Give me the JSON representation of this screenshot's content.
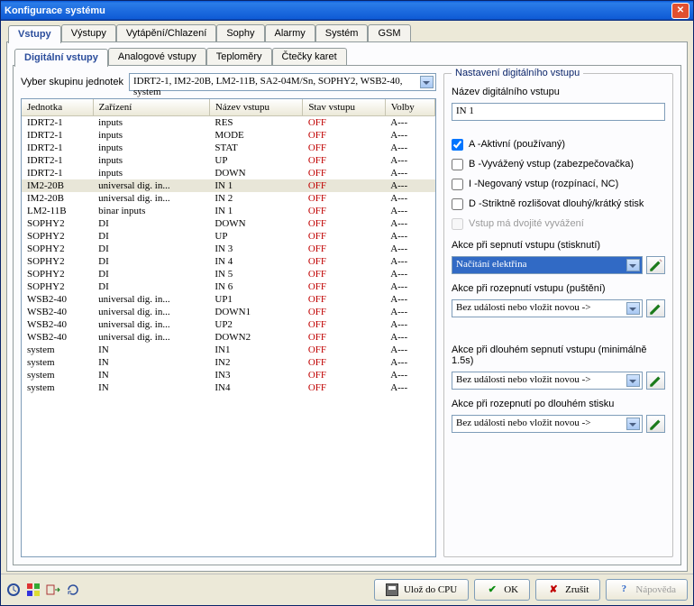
{
  "window": {
    "title": "Konfigurace systému"
  },
  "mainTabs": [
    "Vstupy",
    "Výstupy",
    "Vytápění/Chlazení",
    "Sophy",
    "Alarmy",
    "Systém",
    "GSM"
  ],
  "mainTabActive": 0,
  "subTabs": [
    "Digitální vstupy",
    "Analogové vstupy",
    "Teploměry",
    "Čtečky karet"
  ],
  "subTabActive": 0,
  "picker": {
    "label": "Vyber skupinu jednotek",
    "value": "IDRT2-1, IM2-20B, LM2-11B, SA2-04M/Sn, SOPHY2, WSB2-40, system"
  },
  "columns": [
    "Jednotka",
    "Zařízení",
    "Název vstupu",
    "Stav vstupu",
    "Volby"
  ],
  "rows": [
    {
      "u": "IDRT2-1",
      "d": "inputs",
      "n": "RES",
      "s": "OFF",
      "v": "A---"
    },
    {
      "u": "IDRT2-1",
      "d": "inputs",
      "n": "MODE",
      "s": "OFF",
      "v": "A---"
    },
    {
      "u": "IDRT2-1",
      "d": "inputs",
      "n": "STAT",
      "s": "OFF",
      "v": "A---"
    },
    {
      "u": "IDRT2-1",
      "d": "inputs",
      "n": "UP",
      "s": "OFF",
      "v": "A---"
    },
    {
      "u": "IDRT2-1",
      "d": "inputs",
      "n": "DOWN",
      "s": "OFF",
      "v": "A---"
    },
    {
      "u": "IM2-20B",
      "d": "universal dig. in...",
      "n": "IN 1",
      "s": "OFF",
      "v": "A---",
      "sel": true
    },
    {
      "u": "IM2-20B",
      "d": "universal dig. in...",
      "n": "IN 2",
      "s": "OFF",
      "v": "A---"
    },
    {
      "u": "LM2-11B",
      "d": "binar inputs",
      "n": "IN 1",
      "s": "OFF",
      "v": "A---"
    },
    {
      "u": "SOPHY2",
      "d": "DI",
      "n": "DOWN",
      "s": "OFF",
      "v": "A---"
    },
    {
      "u": "SOPHY2",
      "d": "DI",
      "n": "UP",
      "s": "OFF",
      "v": "A---"
    },
    {
      "u": "SOPHY2",
      "d": "DI",
      "n": "IN 3",
      "s": "OFF",
      "v": "A---"
    },
    {
      "u": "SOPHY2",
      "d": "DI",
      "n": "IN 4",
      "s": "OFF",
      "v": "A---"
    },
    {
      "u": "SOPHY2",
      "d": "DI",
      "n": "IN 5",
      "s": "OFF",
      "v": "A---"
    },
    {
      "u": "SOPHY2",
      "d": "DI",
      "n": "IN 6",
      "s": "OFF",
      "v": "A---"
    },
    {
      "u": "WSB2-40",
      "d": "universal dig. in...",
      "n": "UP1",
      "s": "OFF",
      "v": "A---"
    },
    {
      "u": "WSB2-40",
      "d": "universal dig. in...",
      "n": "DOWN1",
      "s": "OFF",
      "v": "A---"
    },
    {
      "u": "WSB2-40",
      "d": "universal dig. in...",
      "n": "UP2",
      "s": "OFF",
      "v": "A---"
    },
    {
      "u": "WSB2-40",
      "d": "universal dig. in...",
      "n": "DOWN2",
      "s": "OFF",
      "v": "A---"
    },
    {
      "u": "system",
      "d": "IN",
      "n": "IN1",
      "s": "OFF",
      "v": "A---"
    },
    {
      "u": "system",
      "d": "IN",
      "n": "IN2",
      "s": "OFF",
      "v": "A---"
    },
    {
      "u": "system",
      "d": "IN",
      "n": "IN3",
      "s": "OFF",
      "v": "A---"
    },
    {
      "u": "system",
      "d": "IN",
      "n": "IN4",
      "s": "OFF",
      "v": "A---"
    }
  ],
  "settings": {
    "legend": "Nastavení digitálního vstupu",
    "nameLabel": "Název digitálního vstupu",
    "nameValue": "IN 1",
    "chk": {
      "a": "A -Aktivní (používaný)",
      "b": "B -Vyvážený vstup (zabezpečovačka)",
      "i": "I -Negovaný vstup (rozpínací, NC)",
      "d": "D -Striktně rozlišovat dlouhý/krátký stisk",
      "dv": "Vstup má dvojité vyvážení"
    },
    "chkState": {
      "a": true,
      "b": false,
      "i": false,
      "d": false,
      "dv": false
    },
    "actions": {
      "on": {
        "label": "Akce při sepnutí vstupu (stisknutí)",
        "value": "Načítání elektřina"
      },
      "off": {
        "label": "Akce při rozepnutí vstupu (puštění)",
        "value": "Bez události nebo vložit novou ->"
      },
      "long": {
        "label": "Akce při dlouhém sepnutí vstupu (minimálně 1.5s)",
        "value": "Bez události nebo vložit novou ->"
      },
      "rel": {
        "label": "Akce při rozepnutí po dlouhém stisku",
        "value": "Bez události nebo vložit novou ->"
      }
    }
  },
  "bottom": {
    "save": "Ulož do CPU",
    "ok": "OK",
    "cancel": "Zrušit",
    "help": "Nápověda"
  }
}
